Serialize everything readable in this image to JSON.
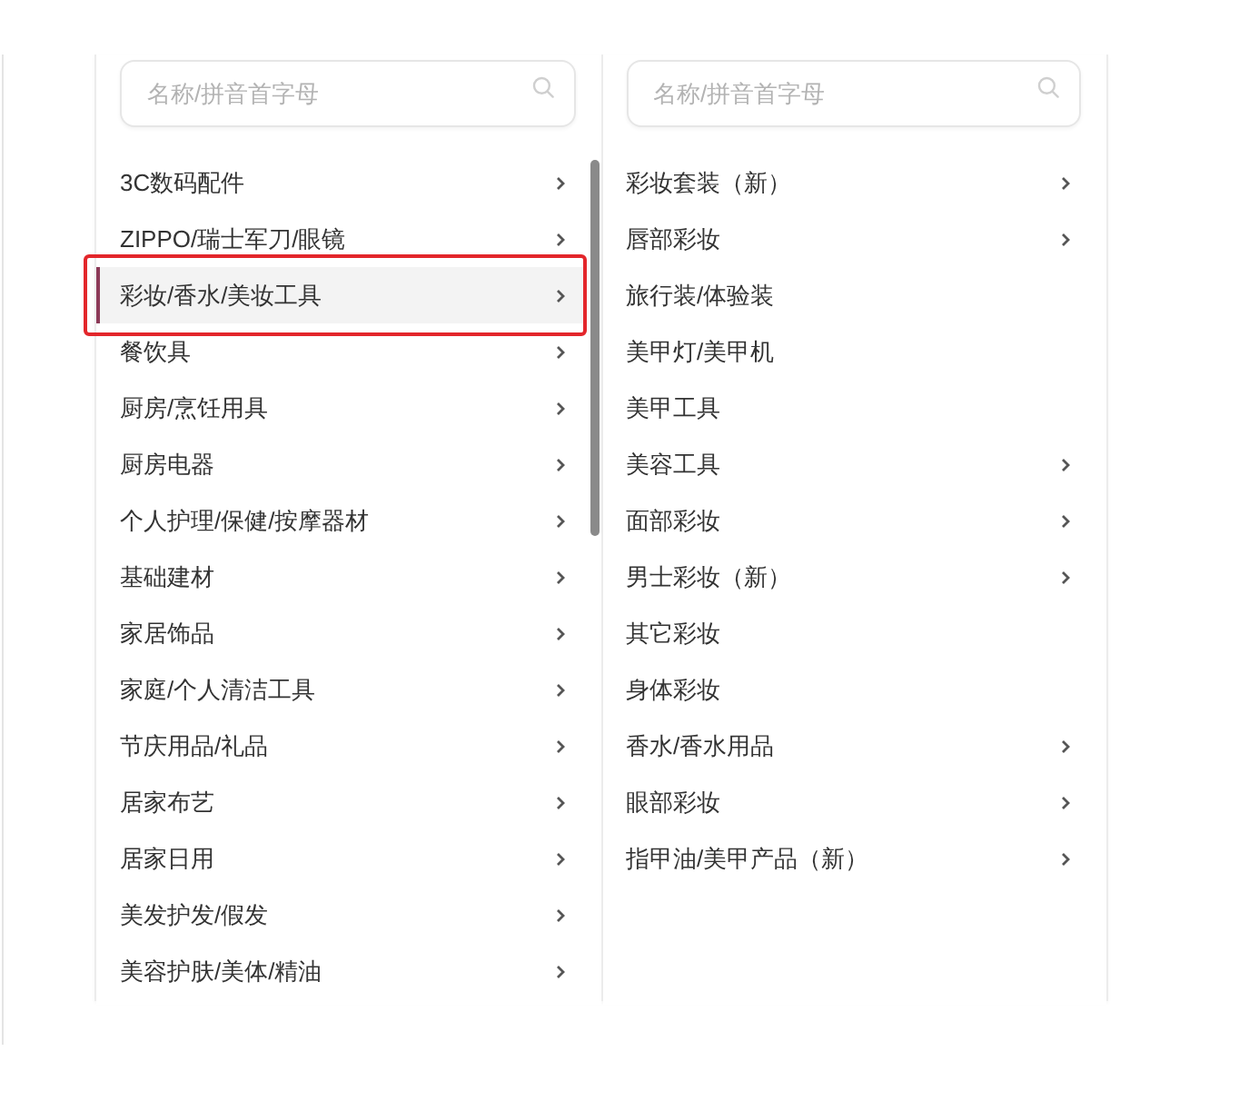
{
  "panels": [
    {
      "search": {
        "placeholder": "名称/拼音首字母"
      },
      "scrollbar": true,
      "items": [
        {
          "label": "3C数码配件",
          "has_submenu": true,
          "selected": false,
          "highlighted": false
        },
        {
          "label": "ZIPPO/瑞士军刀/眼镜",
          "has_submenu": true,
          "selected": false,
          "highlighted": false
        },
        {
          "label": "彩妆/香水/美妆工具",
          "has_submenu": true,
          "selected": true,
          "highlighted": true
        },
        {
          "label": "餐饮具",
          "has_submenu": true,
          "selected": false,
          "highlighted": false
        },
        {
          "label": "厨房/烹饪用具",
          "has_submenu": true,
          "selected": false,
          "highlighted": false
        },
        {
          "label": "厨房电器",
          "has_submenu": true,
          "selected": false,
          "highlighted": false
        },
        {
          "label": "个人护理/保健/按摩器材",
          "has_submenu": true,
          "selected": false,
          "highlighted": false
        },
        {
          "label": "基础建材",
          "has_submenu": true,
          "selected": false,
          "highlighted": false
        },
        {
          "label": "家居饰品",
          "has_submenu": true,
          "selected": false,
          "highlighted": false
        },
        {
          "label": "家庭/个人清洁工具",
          "has_submenu": true,
          "selected": false,
          "highlighted": false
        },
        {
          "label": "节庆用品/礼品",
          "has_submenu": true,
          "selected": false,
          "highlighted": false
        },
        {
          "label": "居家布艺",
          "has_submenu": true,
          "selected": false,
          "highlighted": false
        },
        {
          "label": "居家日用",
          "has_submenu": true,
          "selected": false,
          "highlighted": false
        },
        {
          "label": "美发护发/假发",
          "has_submenu": true,
          "selected": false,
          "highlighted": false
        },
        {
          "label": "美容护肤/美体/精油",
          "has_submenu": true,
          "selected": false,
          "highlighted": false
        }
      ]
    },
    {
      "search": {
        "placeholder": "名称/拼音首字母"
      },
      "scrollbar": false,
      "items": [
        {
          "label": "彩妆套装（新）",
          "has_submenu": true,
          "selected": false,
          "highlighted": false
        },
        {
          "label": "唇部彩妆",
          "has_submenu": true,
          "selected": false,
          "highlighted": false
        },
        {
          "label": "旅行装/体验装",
          "has_submenu": false,
          "selected": false,
          "highlighted": false
        },
        {
          "label": "美甲灯/美甲机",
          "has_submenu": false,
          "selected": false,
          "highlighted": false
        },
        {
          "label": "美甲工具",
          "has_submenu": false,
          "selected": false,
          "highlighted": false
        },
        {
          "label": "美容工具",
          "has_submenu": true,
          "selected": false,
          "highlighted": false
        },
        {
          "label": "面部彩妆",
          "has_submenu": true,
          "selected": false,
          "highlighted": false
        },
        {
          "label": "男士彩妆（新）",
          "has_submenu": true,
          "selected": false,
          "highlighted": false
        },
        {
          "label": "其它彩妆",
          "has_submenu": false,
          "selected": false,
          "highlighted": false
        },
        {
          "label": "身体彩妆",
          "has_submenu": false,
          "selected": false,
          "highlighted": false
        },
        {
          "label": "香水/香水用品",
          "has_submenu": true,
          "selected": false,
          "highlighted": false
        },
        {
          "label": "眼部彩妆",
          "has_submenu": true,
          "selected": false,
          "highlighted": false
        },
        {
          "label": "指甲油/美甲产品（新）",
          "has_submenu": true,
          "selected": false,
          "highlighted": false
        }
      ]
    }
  ]
}
